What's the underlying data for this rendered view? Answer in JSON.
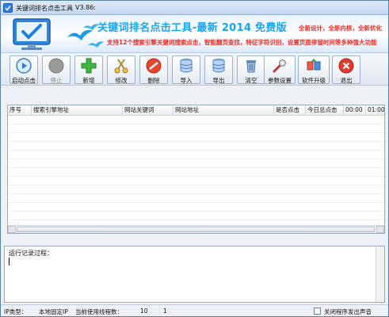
{
  "window": {
    "title": "关键词排名点击工具",
    "version": "V3.86:"
  },
  "banner": {
    "title": "关键词排名点击工具-最新 2014 免费版",
    "subtitle": "支持12个搜索引擎关键词搜索点击，智能翻页查找，特征字符识别，设置页面停留时间等多种强大功能",
    "features": "全新设计，全新内核，全新优化"
  },
  "toolbar": {
    "start": "启动点击",
    "stop": "停止",
    "add": "新增",
    "edit": "修改",
    "delete": "删除",
    "import": "导入",
    "export": "导出",
    "clear": "清空",
    "settings": "参数设置",
    "upgrade": "软件升级",
    "exit": "退出"
  },
  "table": {
    "columns": [
      "序号",
      "搜索引擎地址",
      "网站关键词",
      "网站地址",
      "是否点击",
      "今日总点击",
      "00:00",
      "01:00"
    ]
  },
  "log": {
    "label": "运行记录过程："
  },
  "status": {
    "ip_type_label": "IP类型：",
    "ip_type_value": "本地固定IP",
    "threads_label": "当前使用线程数：",
    "threads_value": "10",
    "threads_extra": "1",
    "sound_label": "关闭程序发出声音"
  },
  "colors": {
    "banner_title": "#1aa5f1",
    "banner_red": "#e2312a",
    "window_border": "#5a7fae"
  }
}
